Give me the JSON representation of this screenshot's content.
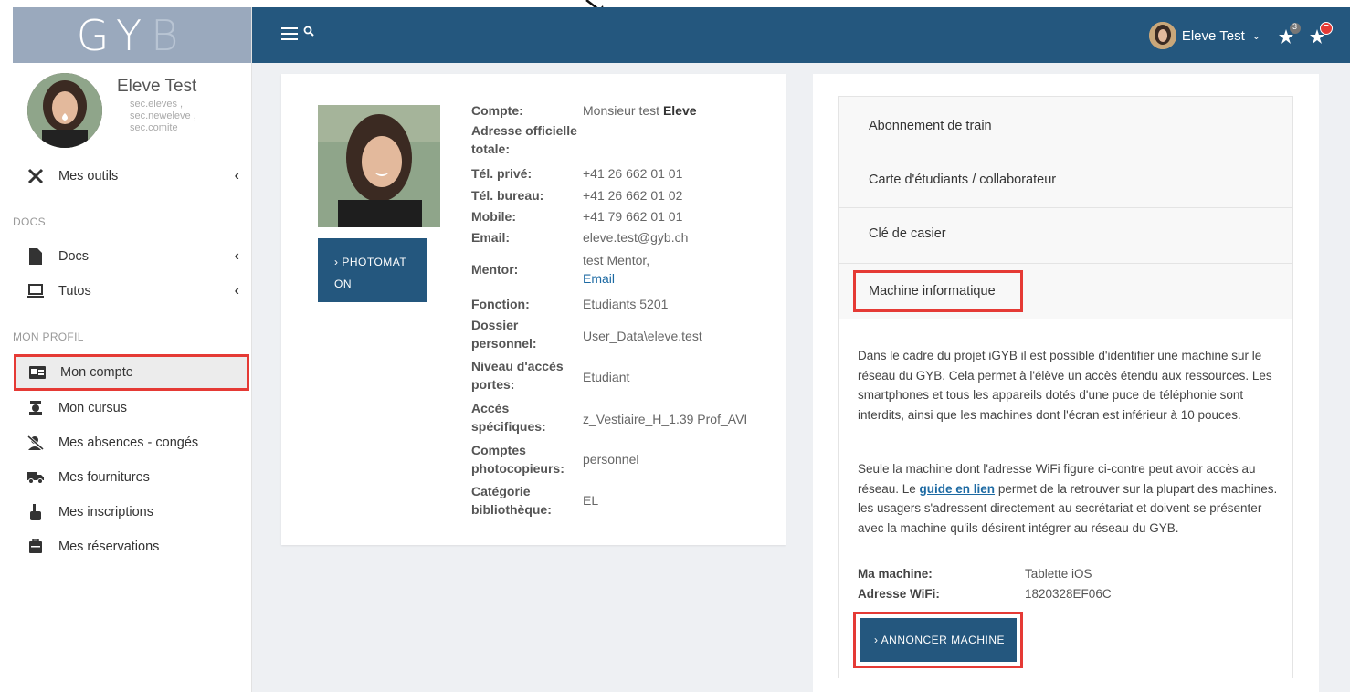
{
  "brand": {
    "logo": "GY",
    "logo_b": "B"
  },
  "user": {
    "name": "Eleve Test",
    "groups": "sec.eleves ,\nsec.neweleve ,\nsec.comite"
  },
  "sidebar": {
    "tools": "Mes outils",
    "docs_section": "DOCS",
    "docs": "Docs",
    "tutos": "Tutos",
    "profile_section": "MON PROFIL",
    "items": [
      {
        "label": "Mon compte"
      },
      {
        "label": "Mon cursus"
      },
      {
        "label": "Mes absences - congés"
      },
      {
        "label": "Mes fournitures"
      },
      {
        "label": "Mes inscriptions"
      },
      {
        "label": "Mes réservations"
      }
    ]
  },
  "topbar": {
    "user_label": "Eleve Test",
    "notif_count": "3",
    "alert_badge": "−"
  },
  "account": {
    "photomaton_line1": "›  PHOTOMAT",
    "photomaton_line2": "ON",
    "rows": [
      {
        "label": "Compte:",
        "value_pre": "Monsieur test ",
        "value_bold": "Eleve"
      },
      {
        "label": "Adresse officielle totale:",
        "value": ""
      },
      {
        "label": "Tél. privé:",
        "value": "+41 26 662 01 01"
      },
      {
        "label": "Tél. bureau:",
        "value": "+41 26 662 01 02"
      },
      {
        "label": "Mobile:",
        "value": "+41 79 662 01 01"
      },
      {
        "label": "Email:",
        "value": "eleve.test@gyb.ch"
      },
      {
        "label": "Mentor:",
        "value": "test Mentor,",
        "link": "Email"
      },
      {
        "label": "Fonction:",
        "value": "Etudiants 5201"
      },
      {
        "label": "Dossier personnel:",
        "value": "User_Data\\eleve.test"
      },
      {
        "label": "Niveau d'accès portes:",
        "value": "Etudiant"
      },
      {
        "label": "Accès spécifiques:",
        "value": "z_Vestiaire_H_1.39 Prof_AVI"
      },
      {
        "label": "Comptes photocopieurs:",
        "value": "personnel"
      },
      {
        "label": "Catégorie bibliothèque:",
        "value": "EL"
      }
    ]
  },
  "accordion": {
    "items": [
      {
        "label": "Abonnement de train"
      },
      {
        "label": "Carte d'étudiants / collaborateur"
      },
      {
        "label": "Clé de casier"
      },
      {
        "label": "Machine informatique"
      }
    ],
    "body": {
      "para1": "Dans le cadre du projet iGYB il est possible d'identifier une machine sur le réseau du GYB. Cela permet à l'élève un accès étendu aux ressources. Les smartphones et tous les appareils dotés d'une puce de téléphonie sont interdits, ainsi que les machines dont l'écran est inférieur à 10 pouces.",
      "para2_a": "Seule la machine dont l'adresse WiFi figure ci-contre peut avoir accès au réseau. Le ",
      "para2_link": "guide en lien",
      "para2_b": " permet de la retrouver sur la plupart des machines. les usagers s'adressent directement au secrétariat et doivent se présenter avec la machine qu'ils désirent intégrer au réseau du GYB.",
      "machine_label": "Ma machine:",
      "machine_value": "Tablette iOS",
      "wifi_label": "Adresse WiFi:",
      "wifi_value": "1820328EF06C",
      "button": "›  ANNONCER MACHINE"
    }
  },
  "colors": {
    "brand": "#24577e",
    "highlight": "#e53a35",
    "logo_bg": "#9aa9bd"
  }
}
